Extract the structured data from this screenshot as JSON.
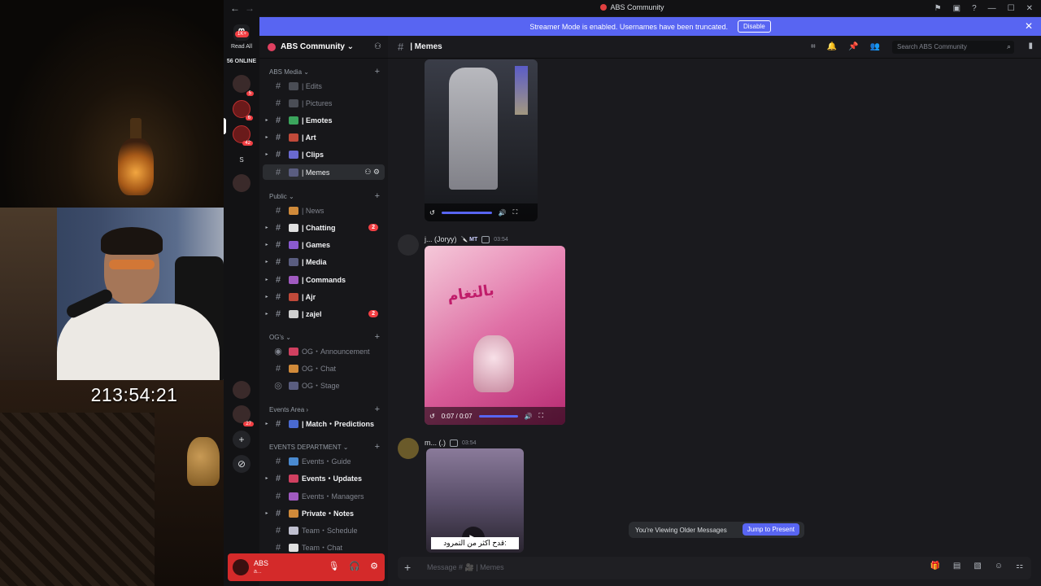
{
  "stream": {
    "timer": "213:54:21"
  },
  "titlebar": {
    "title": "ABS Community",
    "back": "←",
    "forward": "→",
    "icons": [
      "flag-icon",
      "monitor-icon",
      "help-icon",
      "minimize-icon",
      "maximize-icon",
      "close-icon"
    ]
  },
  "banner": {
    "text": "Streamer Mode is enabled. Usernames have been truncated.",
    "button": "Disable",
    "close": "✕"
  },
  "rail": {
    "read_all": "Read All",
    "online": "56 ONLINE",
    "home_badge": "1K+",
    "servers": [
      {
        "badge": "5"
      },
      {
        "badge": "6"
      },
      {
        "badge": "42"
      },
      {
        "badge": ""
      },
      {
        "badge": ""
      },
      {
        "badge": "27"
      }
    ],
    "letter": "S",
    "add": "+",
    "explore": "⊘"
  },
  "server": {
    "name": "ABS Community ⌄"
  },
  "categories": {
    "abs_media": "ABS Media",
    "public": "Public",
    "ogs": "OG's",
    "events_area": "Events Area",
    "events_dept": "EVENTS DEPARTMENT"
  },
  "channels": {
    "edits": "| Edits",
    "pictures": "| Pictures",
    "emotes": "| Emotes",
    "art": "| Art",
    "clips": "| Clips",
    "memes": "| Memes",
    "news": "| News",
    "chatting": "| Chatting",
    "chatting_badge": "2",
    "games": "| Games",
    "media": "| Media",
    "commands": "| Commands",
    "ajr": "| Ajr",
    "zajel": "| zajel",
    "zajel_badge": "2",
    "og_announce": "OG・Announcement",
    "og_chat": "OG・Chat",
    "og_stage": "OG・Stage",
    "match": "| Match・Predictions",
    "ev_guide": "Events・Guide",
    "ev_updates": "Events・Updates",
    "ev_managers": "Events・Managers",
    "private_notes": "Private・Notes",
    "team_schedule": "Team・Schedule",
    "team_chat": "Team・Chat"
  },
  "user": {
    "name": "ABS",
    "status": "a..."
  },
  "header": {
    "channel": "| Memes",
    "search_placeholder": "Search ABS Community"
  },
  "messages": [
    {
      "name": "j... (Joryy)",
      "role": "MT",
      "time": "03:54"
    },
    {
      "name": "m... (.)",
      "role": "",
      "time": "03:54"
    }
  ],
  "video2": {
    "time": "0:07 / 0:07",
    "overlay_text": "بالتغام"
  },
  "video3": {
    "caption": "قدح اكثر من التمرود:"
  },
  "older": {
    "text": "You're Viewing Older Messages",
    "jump": "Jump to Present"
  },
  "composer": {
    "placeholder": "Message # 🎥 | Memes"
  }
}
